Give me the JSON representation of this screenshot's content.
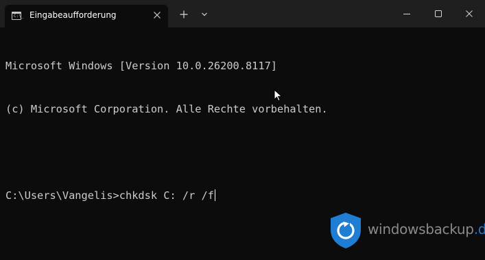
{
  "tab": {
    "title": "Eingabeaufforderung",
    "icon": "command-prompt-icon",
    "icon_text": "C:\\_"
  },
  "titlebar": {
    "new_tab_icon": "plus-icon",
    "dropdown_icon": "chevron-down-icon",
    "minimize_icon": "minimize-icon",
    "maximize_icon": "maximize-icon",
    "close_icon": "close-icon"
  },
  "terminal": {
    "lines": [
      "Microsoft Windows [Version 10.0.26200.8117]",
      "(c) Microsoft Corporation. Alle Rechte vorbehalten.",
      "",
      "C:\\Users\\Vangelis>chkdsk C: /r /f"
    ]
  },
  "watermark": {
    "name": "windowsbackup",
    "tld": ".de",
    "accent_color": "#1f7ed4"
  },
  "colors": {
    "background": "#0c0c0c",
    "titlebar": "#1f1f1f",
    "text": "#cccccc"
  }
}
